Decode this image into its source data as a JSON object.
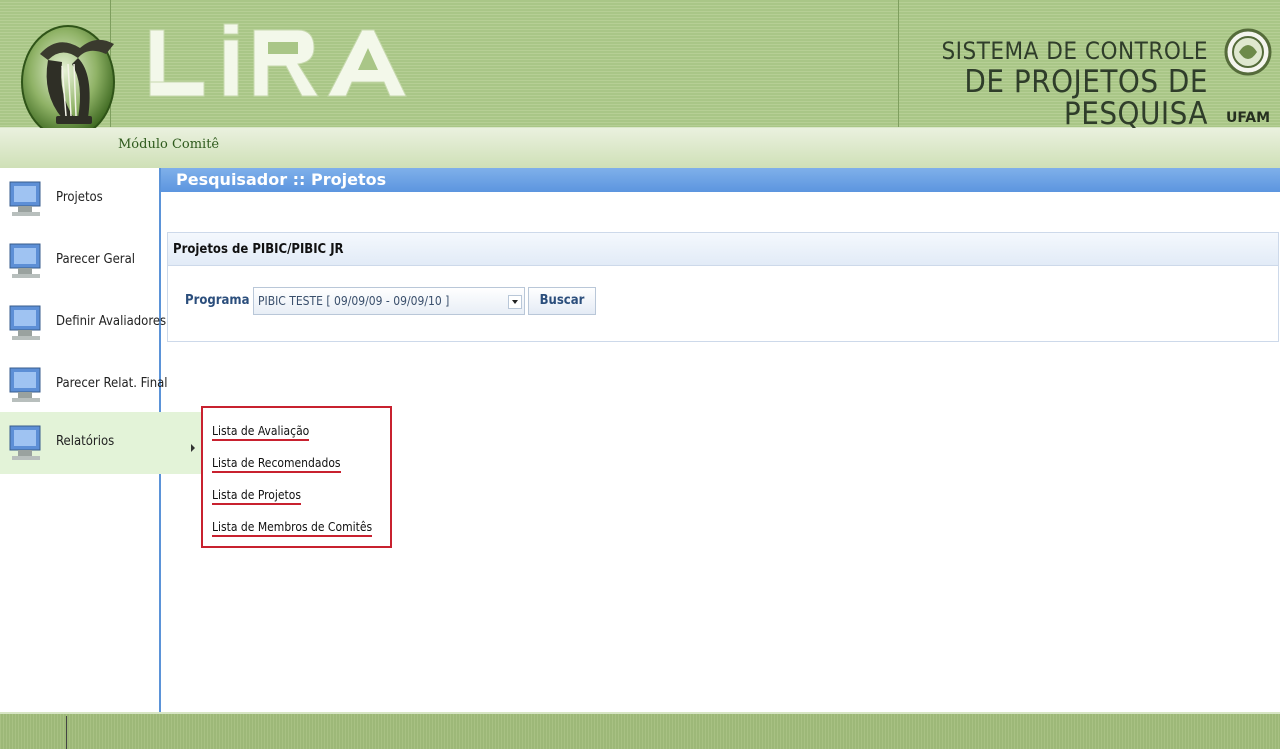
{
  "header": {
    "app_logo_text": "LIRA",
    "system_title_line1": "SISTEMA DE CONTROLE",
    "system_title_line2": "DE PROJETOS DE PESQUISA",
    "institution": "UFAM",
    "module_label": "Módulo Comitê"
  },
  "sidebar": {
    "items": [
      {
        "label": "Projetos",
        "icon": "computer-icon"
      },
      {
        "label": "Parecer Geral",
        "icon": "computer-icon"
      },
      {
        "label": "Definir Avaliadores",
        "icon": "computer-icon"
      },
      {
        "label": "Parecer Relat. Final",
        "icon": "computer-icon"
      },
      {
        "label": "Relatórios",
        "icon": "computer-icon",
        "active": true
      }
    ]
  },
  "main": {
    "page_title": "Pesquisador :: Projetos",
    "panel_title": "Projetos de PIBIC/PIBIC JR",
    "program_label": "Programa",
    "program_selected": "PIBIC TESTE [ 09/09/09 - 09/09/10 ]",
    "search_button": "Buscar"
  },
  "submenu": {
    "items": [
      "Lista de Avaliação",
      "Lista de Recomendados",
      "Lista de Projetos",
      "Lista de Membros de Comitês"
    ]
  },
  "colors": {
    "header_green": "#a9c687",
    "title_bar_blue": "#5c95df",
    "highlight_red": "#c8212f",
    "active_item_bg": "#e3f3d8"
  }
}
